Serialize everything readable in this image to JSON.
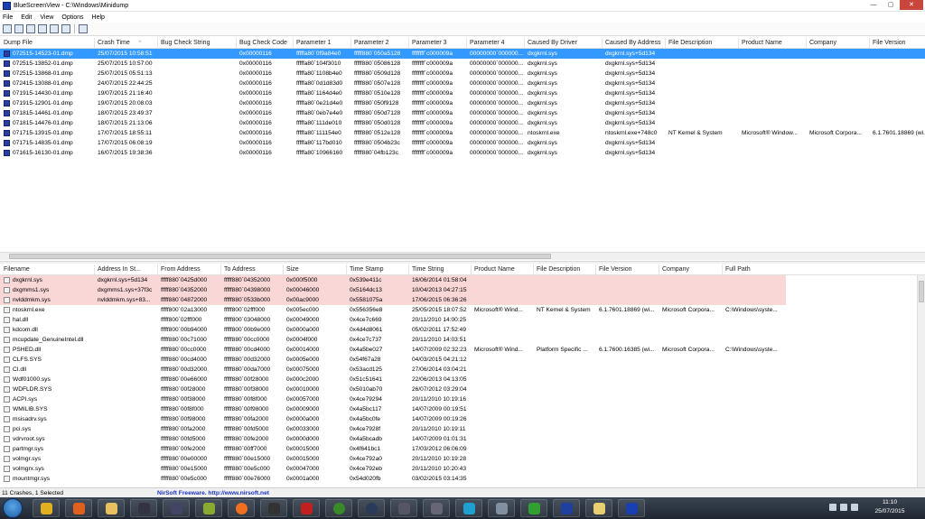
{
  "window": {
    "title": "BlueScreenView  -  C:\\Windows\\Minidump",
    "min": "—",
    "max": "▢",
    "close": "✕"
  },
  "menu": [
    "File",
    "Edit",
    "View",
    "Options",
    "Help"
  ],
  "crashes": {
    "columns": [
      "Dump File",
      "Crash Time",
      "Bug Check String",
      "Bug Check Code",
      "Parameter 1",
      "Parameter 2",
      "Parameter 3",
      "Parameter 4",
      "Caused By Driver",
      "Caused By Address",
      "File Description",
      "Product Name",
      "Company",
      "File Version"
    ],
    "sort_indicator": "⌃",
    "rows": [
      [
        "072515-14523-01.dmp",
        "25/07/2015 10:58:51",
        "",
        "0x00000116",
        "fffffa80`0f9a84e0",
        "fffff880`050a5128",
        "ffffffff`c000009a",
        "00000000`000000...",
        "dxgkrnl.sys",
        "dxgkrnl.sys+5d134",
        "",
        "",
        "",
        ""
      ],
      [
        "072515-13852-01.dmp",
        "25/07/2015 10:57:00",
        "",
        "0x00000116",
        "fffffa80`104f3010",
        "fffff880`05086128",
        "ffffffff`c000009a",
        "00000000`000000...",
        "dxgkrnl.sys",
        "dxgkrnl.sys+5d134",
        "",
        "",
        "",
        ""
      ],
      [
        "072515-13868-01.dmp",
        "25/07/2015 05:51:13",
        "",
        "0x00000116",
        "fffffa80`1108b4e0",
        "fffff880`0509d128",
        "ffffffff`c000009a",
        "00000000`000000...",
        "dxgkrnl.sys",
        "dxgkrnl.sys+5d134",
        "",
        "",
        "",
        ""
      ],
      [
        "072415-13088-01.dmp",
        "24/07/2015 22:44:25",
        "",
        "0x00000116",
        "fffffa80`0d1d83d0",
        "fffff880`0507e128",
        "ffffffff`c000009a",
        "00000000`000000...",
        "dxgkrnl.sys",
        "dxgkrnl.sys+5d134",
        "",
        "",
        "",
        ""
      ],
      [
        "071915-14430-01.dmp",
        "19/07/2015 21:16:40",
        "",
        "0x00000116",
        "fffffa80`1164d4e0",
        "fffff880`0510e128",
        "ffffffff`c000009a",
        "00000000`000000...",
        "dxgkrnl.sys",
        "dxgkrnl.sys+5d134",
        "",
        "",
        "",
        ""
      ],
      [
        "071915-12901-01.dmp",
        "19/07/2015 20:08:03",
        "",
        "0x00000116",
        "fffffa80`0e21d4e0",
        "fffff880`050f9128",
        "ffffffff`c000009a",
        "00000000`000000...",
        "dxgkrnl.sys",
        "dxgkrnl.sys+5d134",
        "",
        "",
        "",
        ""
      ],
      [
        "071815-14461-01.dmp",
        "18/07/2015 23:49:37",
        "",
        "0x00000116",
        "fffffa80`0eb7e4e0",
        "fffff880`050d7128",
        "ffffffff`c000009a",
        "00000000`000000...",
        "dxgkrnl.sys",
        "dxgkrnl.sys+5d134",
        "",
        "",
        "",
        ""
      ],
      [
        "071815-14476-01.dmp",
        "18/07/2015 21:13:06",
        "",
        "0x00000116",
        "fffffa80`111de010",
        "fffff880`050d0128",
        "ffffffff`c000009a",
        "00000000`000000...",
        "dxgkrnl.sys",
        "dxgkrnl.sys+5d134",
        "",
        "",
        "",
        ""
      ],
      [
        "071715-13915-01.dmp",
        "17/07/2015 18:55:11",
        "",
        "0x00000116",
        "fffffa80`111154e0",
        "fffff880`0512e128",
        "ffffffff`c000009a",
        "00000000`000000...",
        "ntoskrnl.exe",
        "ntoskrnl.exe+748c0",
        "NT Kernel & System",
        "Microsoft® Window...",
        "Microsoft Corpora...",
        "6.1.7601.18869 (wi..."
      ],
      [
        "071715-14835-01.dmp",
        "17/07/2015 06:08:19",
        "",
        "0x00000116",
        "fffffa80`117bd010",
        "fffff880`0504b23c",
        "ffffffff`c000009a",
        "00000000`000000...",
        "dxgkrnl.sys",
        "dxgkrnl.sys+5d134",
        "",
        "",
        "",
        ""
      ],
      [
        "071615-16130-01.dmp",
        "16/07/2015 19:38:36",
        "",
        "0x00000116",
        "fffffa80`10966160",
        "fffff880`04fb123c",
        "ffffffff`c000009a",
        "00000000`000000...",
        "dxgkrnl.sys",
        "dxgkrnl.sys+5d134",
        "",
        "",
        "",
        ""
      ]
    ]
  },
  "drivers": {
    "columns": [
      "Filename",
      "Address In St...",
      "From Address",
      "To Address",
      "Size",
      "Time Stamp",
      "Time String",
      "Product Name",
      "File Description",
      "File Version",
      "Company",
      "Full Path"
    ],
    "rows": [
      [
        "dxgkrnl.sys",
        "dxgkrnl.sys+5d134",
        "fffff880`0425d000",
        "fffff880`04352000",
        "0x000f5000",
        "0x539e411c",
        "16/06/2014 01:58:04",
        "",
        "",
        "",
        "",
        ""
      ],
      [
        "dxgmms1.sys",
        "dxgmms1.sys+37f3c",
        "fffff880`04352000",
        "fffff880`04398000",
        "0x00046000",
        "0x5164dc13",
        "10/04/2013 04:27:15",
        "",
        "",
        "",
        "",
        ""
      ],
      [
        "nvlddmkm.sys",
        "nvlddmkm.sys+83...",
        "fffff880`04872000",
        "fffff880`0533b000",
        "0x00ac9000",
        "0x5581075a",
        "17/06/2015 06:36:26",
        "",
        "",
        "",
        "",
        ""
      ],
      [
        "ntoskrnl.exe",
        "",
        "fffff800`02a13000",
        "fffff800`02fff000",
        "0x005ec000",
        "0x556356e8",
        "25/05/2015 18:07:52",
        "Microsoft® Wind...",
        "NT Kernel & System",
        "6.1.7601.18869 (wi...",
        "Microsoft Corpora...",
        "C:\\Windows\\syste..."
      ],
      [
        "hal.dll",
        "",
        "fffff800`02fff000",
        "fffff800`03048000",
        "0x00049000",
        "0x4ce7c669",
        "20/11/2010 14:00:25",
        "",
        "",
        "",
        "",
        ""
      ],
      [
        "kdcom.dll",
        "",
        "fffff800`00b94000",
        "fffff800`00b9e000",
        "0x0000a000",
        "0x4d4d8061",
        "05/02/2011 17:52:49",
        "",
        "",
        "",
        "",
        ""
      ],
      [
        "mcupdate_GenuineIntel.dll",
        "",
        "fffff880`00c71000",
        "fffff880`00cc0000",
        "0x0004f000",
        "0x4ce7c737",
        "20/11/2010 14:03:51",
        "",
        "",
        "",
        "",
        ""
      ],
      [
        "PSHED.dll",
        "",
        "fffff880`00cc0000",
        "fffff880`00cd4000",
        "0x00014000",
        "0x4a5be027",
        "14/07/2009 02:32:23",
        "Microsoft® Wind...",
        "Platform Specific ...",
        "6.1.7600.16385 (wi...",
        "Microsoft Corpora...",
        "C:\\Windows\\syste..."
      ],
      [
        "CLFS.SYS",
        "",
        "fffff880`00cd4000",
        "fffff880`00d32000",
        "0x0005e000",
        "0x54f67a28",
        "04/03/2015 04:21:12",
        "",
        "",
        "",
        "",
        ""
      ],
      [
        "CI.dll",
        "",
        "fffff880`00d32000",
        "fffff880`00da7000",
        "0x00075000",
        "0x53acd125",
        "27/06/2014 03:04:21",
        "",
        "",
        "",
        "",
        ""
      ],
      [
        "Wdf01000.sys",
        "",
        "fffff880`00e66000",
        "fffff880`00f28000",
        "0x000c2000",
        "0x51c51641",
        "22/06/2013 04:13:05",
        "",
        "",
        "",
        "",
        ""
      ],
      [
        "WDFLDR.SYS",
        "",
        "fffff880`00f28000",
        "fffff880`00f38000",
        "0x00010000",
        "0x5010ab70",
        "26/07/2012 03:29:04",
        "",
        "",
        "",
        "",
        ""
      ],
      [
        "ACPI.sys",
        "",
        "fffff880`00f38000",
        "fffff880`00f8f000",
        "0x00057000",
        "0x4ce79294",
        "20/11/2010 10:19:16",
        "",
        "",
        "",
        "",
        ""
      ],
      [
        "WMILIB.SYS",
        "",
        "fffff880`00f8f000",
        "fffff880`00f98000",
        "0x00009000",
        "0x4a5bc117",
        "14/07/2009 00:19:51",
        "",
        "",
        "",
        "",
        ""
      ],
      [
        "msisadrv.sys",
        "",
        "fffff880`00f98000",
        "fffff880`00fa2000",
        "0x0000a000",
        "0x4a5bc0fe",
        "14/07/2009 00:19:26",
        "",
        "",
        "",
        "",
        ""
      ],
      [
        "pci.sys",
        "",
        "fffff880`00fa2000",
        "fffff880`00fd5000",
        "0x00033000",
        "0x4ce7928f",
        "20/11/2010 10:19:11",
        "",
        "",
        "",
        "",
        ""
      ],
      [
        "vdrvroot.sys",
        "",
        "fffff880`00fd5000",
        "fffff880`00fe2000",
        "0x0000d000",
        "0x4a5bcadb",
        "14/07/2009 01:01:31",
        "",
        "",
        "",
        "",
        ""
      ],
      [
        "partmgr.sys",
        "",
        "fffff880`00fe2000",
        "fffff880`00ff7000",
        "0x00015000",
        "0x4f641bc1",
        "17/03/2012 06:06:09",
        "",
        "",
        "",
        "",
        ""
      ],
      [
        "volmgr.sys",
        "",
        "fffff880`00e00000",
        "fffff880`00e15000",
        "0x00015000",
        "0x4ce792a0",
        "20/11/2010 10:19:28",
        "",
        "",
        "",
        "",
        ""
      ],
      [
        "volmgrx.sys",
        "",
        "fffff880`00e15000",
        "fffff880`00e5c000",
        "0x00047000",
        "0x4ce792eb",
        "20/11/2010 10:20:43",
        "",
        "",
        "",
        "",
        ""
      ],
      [
        "mountmgr.sys",
        "",
        "fffff880`00e5c000",
        "fffff880`00e76000",
        "0x0001a000",
        "0x54d020fb",
        "03/02/2015 03:14:35",
        "",
        "",
        "",
        "",
        ""
      ]
    ]
  },
  "status": {
    "summary": "11 Crashes, 1 Selected",
    "credit": "NirSoft Freeware.  http://www.nirsoft.net"
  },
  "clock": {
    "time": "11:10",
    "date": "25/07/2015"
  },
  "colors": {
    "selection": "#3399ff",
    "highlight": "#fad7d7",
    "credit": "#1a33c0"
  }
}
